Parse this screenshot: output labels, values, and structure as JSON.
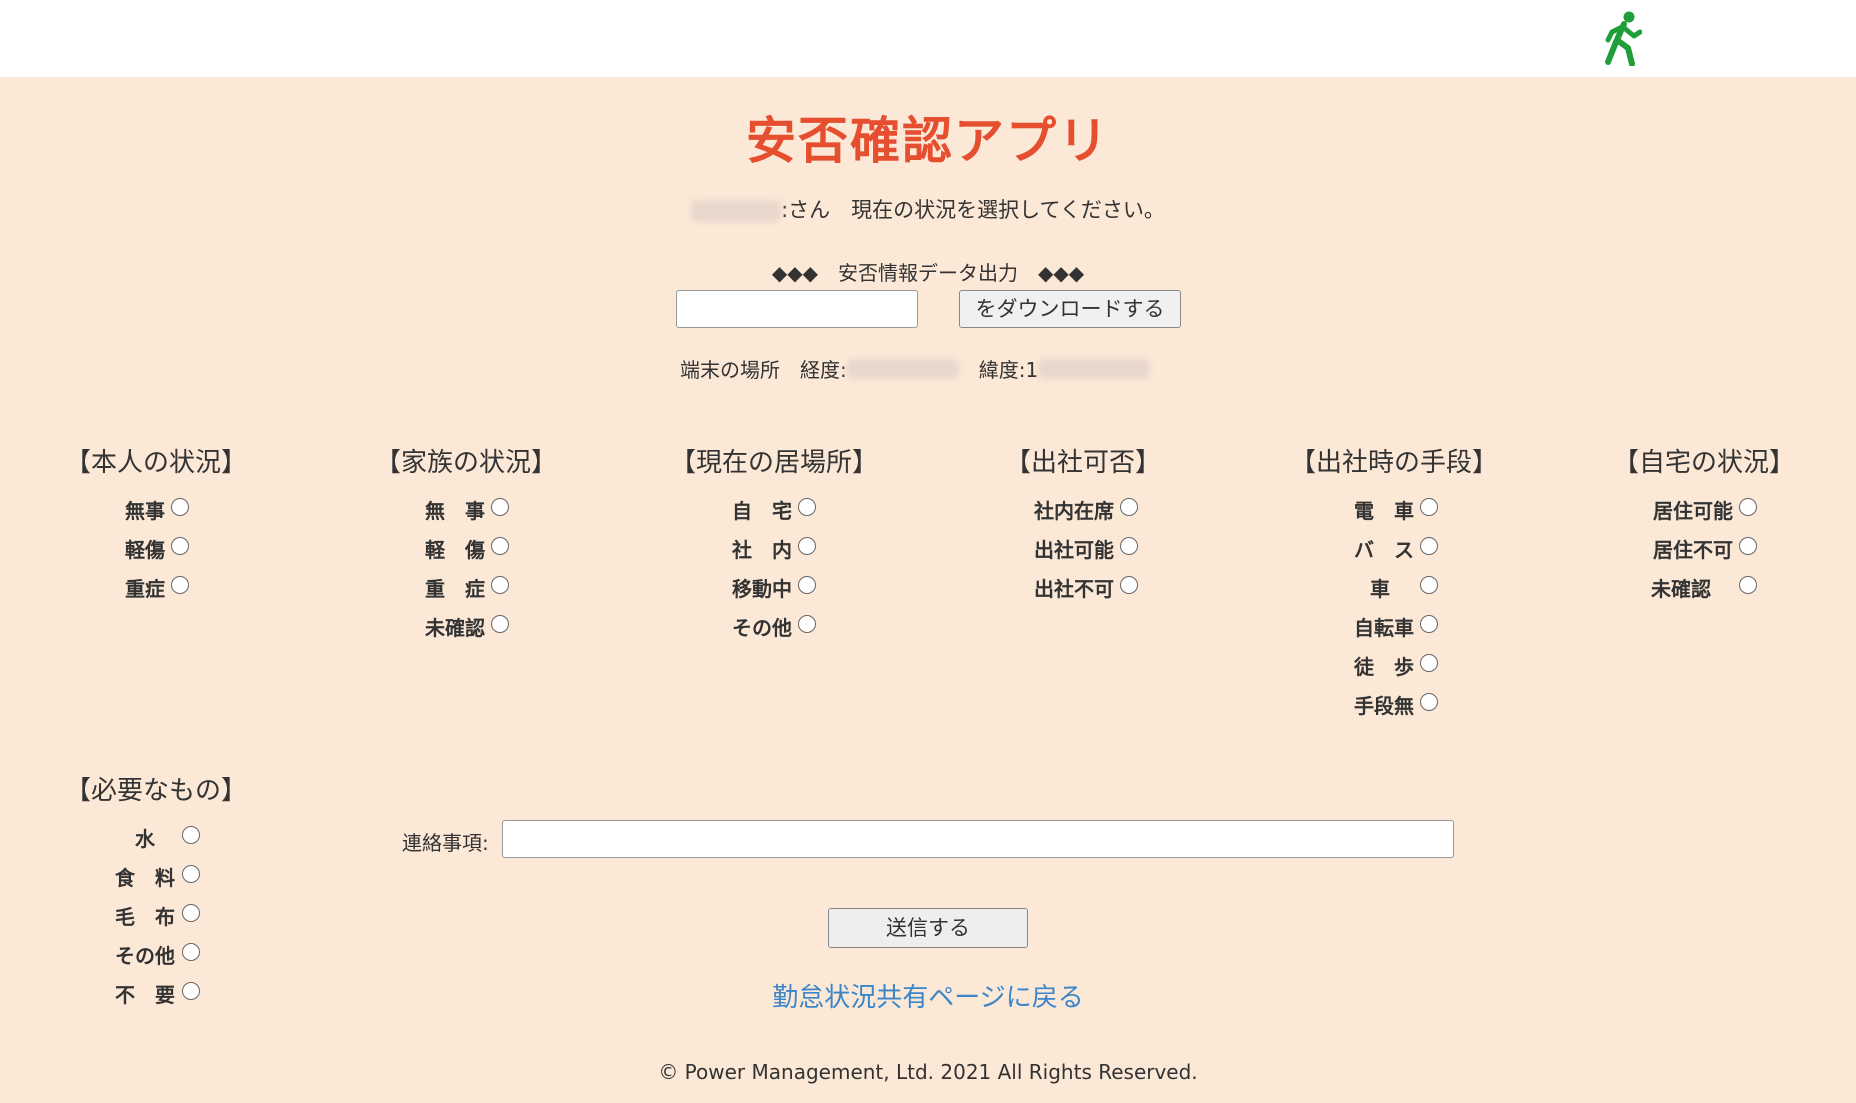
{
  "header": {
    "icon": "running-person-icon",
    "icon_color": "#1f9e3a"
  },
  "title": "安否確認アプリ",
  "greeting": ":さん　現在の状況を選択してください。",
  "export": {
    "heading": "◆◆◆　安否情報データ出力　◆◆◆",
    "input_value": "",
    "button_label": "をダウンロードする"
  },
  "location": {
    "label": "端末の場所",
    "longitude_label": "経度:",
    "latitude_label": "緯度:1"
  },
  "sections": [
    {
      "heading": "【本人の状況】",
      "options": [
        "無事",
        "軽傷",
        "重症"
      ]
    },
    {
      "heading": "【家族の状況】",
      "options": [
        "無　事",
        "軽　傷",
        "重　症",
        "未確認"
      ]
    },
    {
      "heading": "【現在の居場所】",
      "options": [
        "自　宅",
        "社　内",
        "移動中",
        "その他"
      ]
    },
    {
      "heading": "【出社可否】",
      "options": [
        "社内在席",
        "出社可能",
        "出社不可"
      ]
    },
    {
      "heading": "【出社時の手段】",
      "options": [
        "電　車",
        "バ　ス",
        "車",
        "自転車",
        "徒　歩",
        "手段無"
      ]
    },
    {
      "heading": "【自宅の状況】",
      "options": [
        "居住可能",
        "居住不可",
        "未確認"
      ]
    },
    {
      "heading": "【必要なもの】",
      "options": [
        "水",
        "食　料",
        "毛　布",
        "その他",
        "不　要"
      ]
    }
  ],
  "contact": {
    "label": "連絡事項:",
    "value": ""
  },
  "submit_label": "送信する",
  "back_link": "勤怠状況共有ページに戻る",
  "footer": "© Power  Management, Ltd. 2021 All Rights Reserved.",
  "colors": {
    "title": "#e54e2e",
    "background": "#fce8d7",
    "link": "#3a86c8"
  }
}
